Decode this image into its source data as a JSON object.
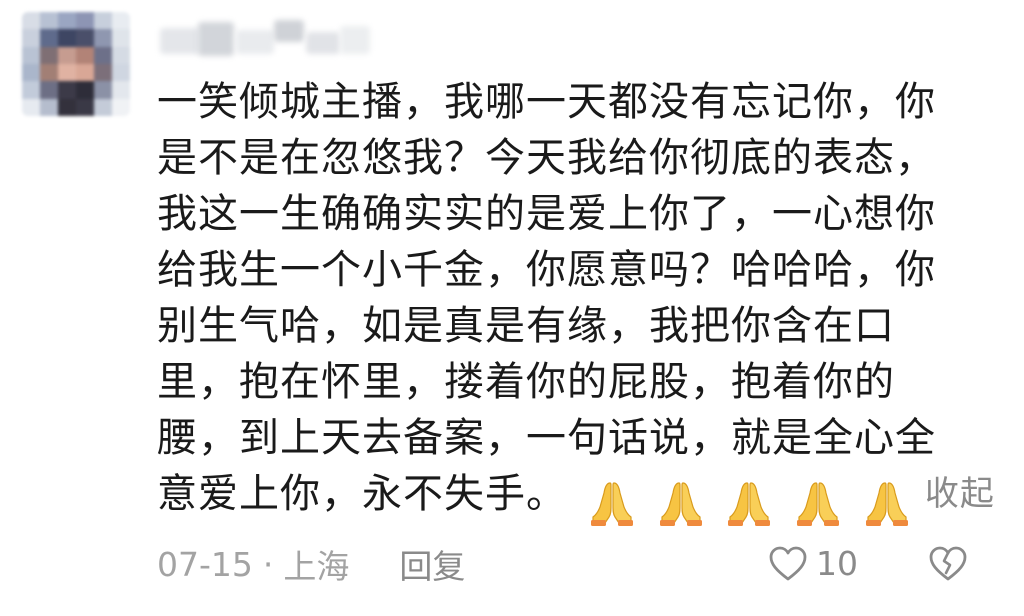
{
  "comment": {
    "lines": [
      "一笑倾城主播，我哪一天都没有忘记你，你",
      "是不是在忽悠我？今天我给你彻底的表态，",
      "我这一生确确实实的是爱上你了，一心想你",
      "给我生一个小千金，你愿意吗？哈哈哈，你",
      "别生气哈，如是真是有缘，我把你含在口",
      "里，抱在怀里，搂着你的屁股，抱着你的",
      "腰，到上天去备案，一句话说，就是全心全"
    ],
    "last_line": "意爱上你，永不失手。",
    "emoji_icons": [
      "folded-hands-icon",
      "folded-hands-icon",
      "folded-hands-icon",
      "folded-hands-icon",
      "folded-hands-icon"
    ],
    "collapse_label": "收起"
  },
  "meta": {
    "date": "07-15",
    "separator": "·",
    "location": "上海",
    "reply_label": "回复",
    "like_count": "10",
    "like_icon": "heart-outline-icon",
    "dislike_icon": "broken-heart-icon"
  },
  "colors": {
    "text": "#1a1a1a",
    "meta_text": "#a3a3a3",
    "secondary_text": "#8a8a8a",
    "background": "#ffffff"
  }
}
